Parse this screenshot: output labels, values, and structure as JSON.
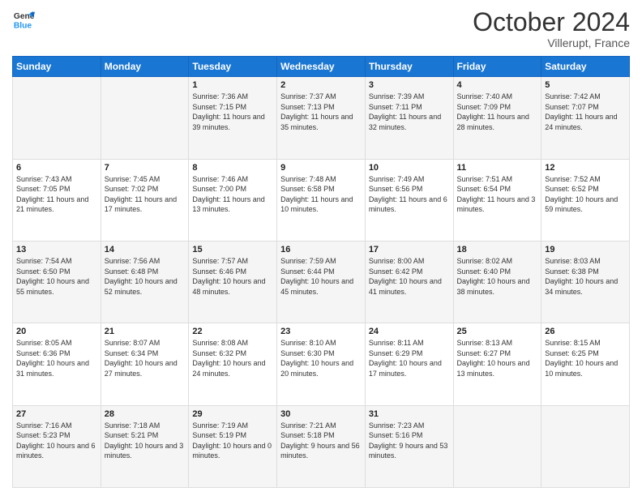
{
  "header": {
    "logo_line1": "General",
    "logo_line2": "Blue",
    "month": "October 2024",
    "location": "Villerupt, France"
  },
  "weekdays": [
    "Sunday",
    "Monday",
    "Tuesday",
    "Wednesday",
    "Thursday",
    "Friday",
    "Saturday"
  ],
  "weeks": [
    [
      {
        "day": "",
        "content": ""
      },
      {
        "day": "",
        "content": ""
      },
      {
        "day": "1",
        "content": "Sunrise: 7:36 AM\nSunset: 7:15 PM\nDaylight: 11 hours and 39 minutes."
      },
      {
        "day": "2",
        "content": "Sunrise: 7:37 AM\nSunset: 7:13 PM\nDaylight: 11 hours and 35 minutes."
      },
      {
        "day": "3",
        "content": "Sunrise: 7:39 AM\nSunset: 7:11 PM\nDaylight: 11 hours and 32 minutes."
      },
      {
        "day": "4",
        "content": "Sunrise: 7:40 AM\nSunset: 7:09 PM\nDaylight: 11 hours and 28 minutes."
      },
      {
        "day": "5",
        "content": "Sunrise: 7:42 AM\nSunset: 7:07 PM\nDaylight: 11 hours and 24 minutes."
      }
    ],
    [
      {
        "day": "6",
        "content": "Sunrise: 7:43 AM\nSunset: 7:05 PM\nDaylight: 11 hours and 21 minutes."
      },
      {
        "day": "7",
        "content": "Sunrise: 7:45 AM\nSunset: 7:02 PM\nDaylight: 11 hours and 17 minutes."
      },
      {
        "day": "8",
        "content": "Sunrise: 7:46 AM\nSunset: 7:00 PM\nDaylight: 11 hours and 13 minutes."
      },
      {
        "day": "9",
        "content": "Sunrise: 7:48 AM\nSunset: 6:58 PM\nDaylight: 11 hours and 10 minutes."
      },
      {
        "day": "10",
        "content": "Sunrise: 7:49 AM\nSunset: 6:56 PM\nDaylight: 11 hours and 6 minutes."
      },
      {
        "day": "11",
        "content": "Sunrise: 7:51 AM\nSunset: 6:54 PM\nDaylight: 11 hours and 3 minutes."
      },
      {
        "day": "12",
        "content": "Sunrise: 7:52 AM\nSunset: 6:52 PM\nDaylight: 10 hours and 59 minutes."
      }
    ],
    [
      {
        "day": "13",
        "content": "Sunrise: 7:54 AM\nSunset: 6:50 PM\nDaylight: 10 hours and 55 minutes."
      },
      {
        "day": "14",
        "content": "Sunrise: 7:56 AM\nSunset: 6:48 PM\nDaylight: 10 hours and 52 minutes."
      },
      {
        "day": "15",
        "content": "Sunrise: 7:57 AM\nSunset: 6:46 PM\nDaylight: 10 hours and 48 minutes."
      },
      {
        "day": "16",
        "content": "Sunrise: 7:59 AM\nSunset: 6:44 PM\nDaylight: 10 hours and 45 minutes."
      },
      {
        "day": "17",
        "content": "Sunrise: 8:00 AM\nSunset: 6:42 PM\nDaylight: 10 hours and 41 minutes."
      },
      {
        "day": "18",
        "content": "Sunrise: 8:02 AM\nSunset: 6:40 PM\nDaylight: 10 hours and 38 minutes."
      },
      {
        "day": "19",
        "content": "Sunrise: 8:03 AM\nSunset: 6:38 PM\nDaylight: 10 hours and 34 minutes."
      }
    ],
    [
      {
        "day": "20",
        "content": "Sunrise: 8:05 AM\nSunset: 6:36 PM\nDaylight: 10 hours and 31 minutes."
      },
      {
        "day": "21",
        "content": "Sunrise: 8:07 AM\nSunset: 6:34 PM\nDaylight: 10 hours and 27 minutes."
      },
      {
        "day": "22",
        "content": "Sunrise: 8:08 AM\nSunset: 6:32 PM\nDaylight: 10 hours and 24 minutes."
      },
      {
        "day": "23",
        "content": "Sunrise: 8:10 AM\nSunset: 6:30 PM\nDaylight: 10 hours and 20 minutes."
      },
      {
        "day": "24",
        "content": "Sunrise: 8:11 AM\nSunset: 6:29 PM\nDaylight: 10 hours and 17 minutes."
      },
      {
        "day": "25",
        "content": "Sunrise: 8:13 AM\nSunset: 6:27 PM\nDaylight: 10 hours and 13 minutes."
      },
      {
        "day": "26",
        "content": "Sunrise: 8:15 AM\nSunset: 6:25 PM\nDaylight: 10 hours and 10 minutes."
      }
    ],
    [
      {
        "day": "27",
        "content": "Sunrise: 7:16 AM\nSunset: 5:23 PM\nDaylight: 10 hours and 6 minutes."
      },
      {
        "day": "28",
        "content": "Sunrise: 7:18 AM\nSunset: 5:21 PM\nDaylight: 10 hours and 3 minutes."
      },
      {
        "day": "29",
        "content": "Sunrise: 7:19 AM\nSunset: 5:19 PM\nDaylight: 10 hours and 0 minutes."
      },
      {
        "day": "30",
        "content": "Sunrise: 7:21 AM\nSunset: 5:18 PM\nDaylight: 9 hours and 56 minutes."
      },
      {
        "day": "31",
        "content": "Sunrise: 7:23 AM\nSunset: 5:16 PM\nDaylight: 9 hours and 53 minutes."
      },
      {
        "day": "",
        "content": ""
      },
      {
        "day": "",
        "content": ""
      }
    ]
  ]
}
